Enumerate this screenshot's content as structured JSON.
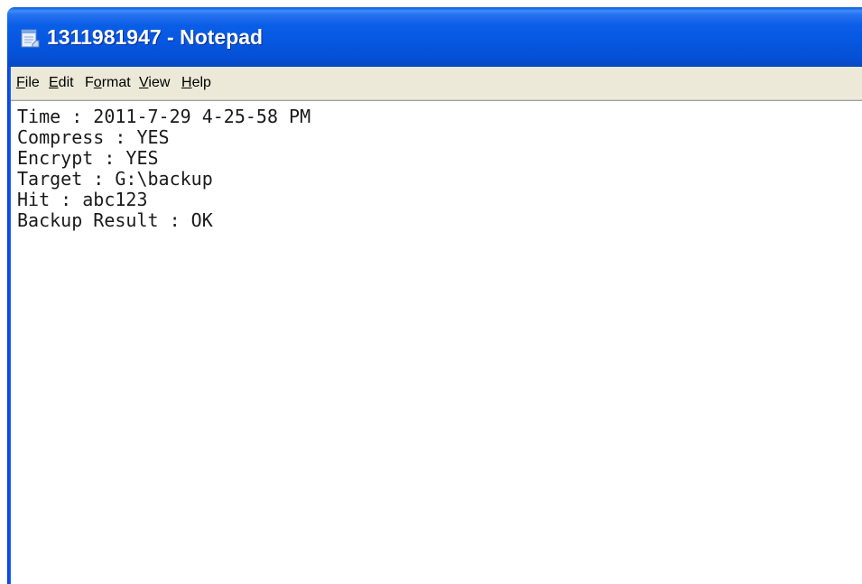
{
  "window": {
    "title": "1311981947 - Notepad",
    "icon": "notepad-icon"
  },
  "menu": {
    "items": [
      {
        "accel": "F",
        "rest": "ile"
      },
      {
        "accel": "E",
        "rest": "dit"
      },
      {
        "pre": "F",
        "accel": "o",
        "rest": "rmat"
      },
      {
        "accel": "V",
        "rest": "iew"
      },
      {
        "accel": "H",
        "rest": "elp"
      }
    ]
  },
  "document": {
    "lines": [
      "Time : 2011-7-29 4-25-58 PM",
      "Compress : YES",
      "Encrypt : YES",
      "Target : G:\\backup",
      "Hit : abc123",
      "Backup Result : OK"
    ]
  },
  "colors": {
    "titlebar": "#0656e0",
    "menubar": "#ece9d8"
  }
}
